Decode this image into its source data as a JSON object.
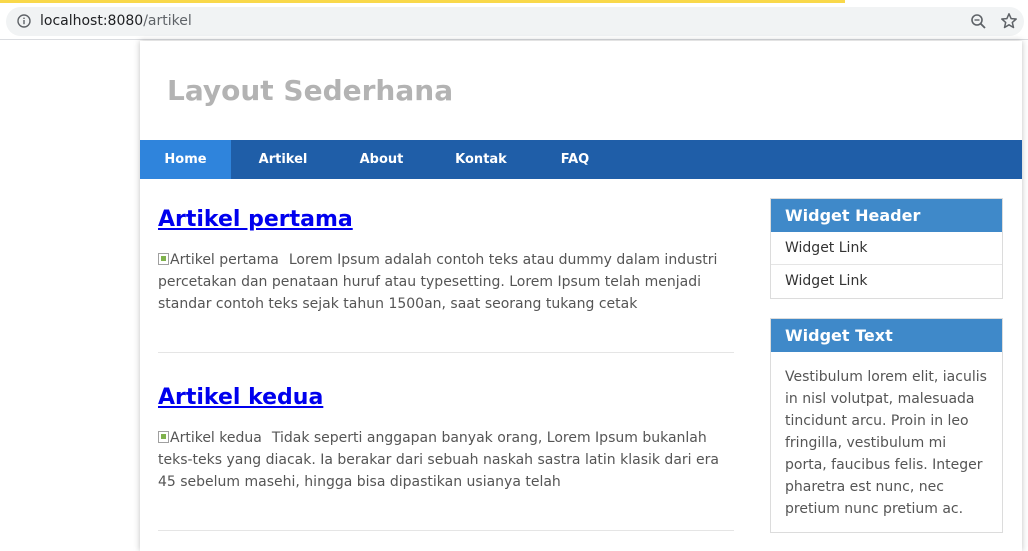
{
  "browser": {
    "url_host": "localhost:8080",
    "url_path": "/artikel",
    "icons": [
      "info-icon",
      "zoom-icon",
      "star-icon"
    ]
  },
  "site": {
    "title": "Layout Sederhana"
  },
  "nav": {
    "items": [
      {
        "label": "Home",
        "active": true
      },
      {
        "label": "Artikel",
        "active": false
      },
      {
        "label": "About",
        "active": false
      },
      {
        "label": "Kontak",
        "active": false
      },
      {
        "label": "FAQ",
        "active": false
      }
    ]
  },
  "articles": [
    {
      "title": "Artikel pertama",
      "image_alt": "Artikel pertama",
      "excerpt": "Lorem Ipsum adalah contoh teks atau dummy dalam industri percetakan dan penataan huruf atau typesetting. Lorem Ipsum telah menjadi standar contoh teks sejak tahun 1500an, saat seorang tukang cetak"
    },
    {
      "title": "Artikel kedua",
      "image_alt": "Artikel kedua",
      "excerpt": "Tidak seperti anggapan banyak orang, Lorem Ipsum bukanlah teks-teks yang diacak. Ia berakar dari sebuah naskah sastra latin klasik dari era 45 sebelum masehi, hingga bisa dipastikan usianya telah"
    }
  ],
  "sidebar": {
    "widget_links": {
      "header": "Widget Header",
      "links": [
        "Widget Link",
        "Widget Link"
      ]
    },
    "widget_text": {
      "header": "Widget Text",
      "body": "Vestibulum lorem elit, iaculis in nisl volutpat, malesuada tincidunt arcu. Proin in leo fringilla, vestibulum mi porta, faucibus felis. Integer pharetra est nunc, nec pretium nunc pretium ac."
    }
  },
  "colors": {
    "nav_bg": "#1f5ea8",
    "nav_active": "#2f84dc",
    "widget_header": "#3f89c9",
    "link": "#0000ee",
    "site_title": "#b3b3b3"
  }
}
